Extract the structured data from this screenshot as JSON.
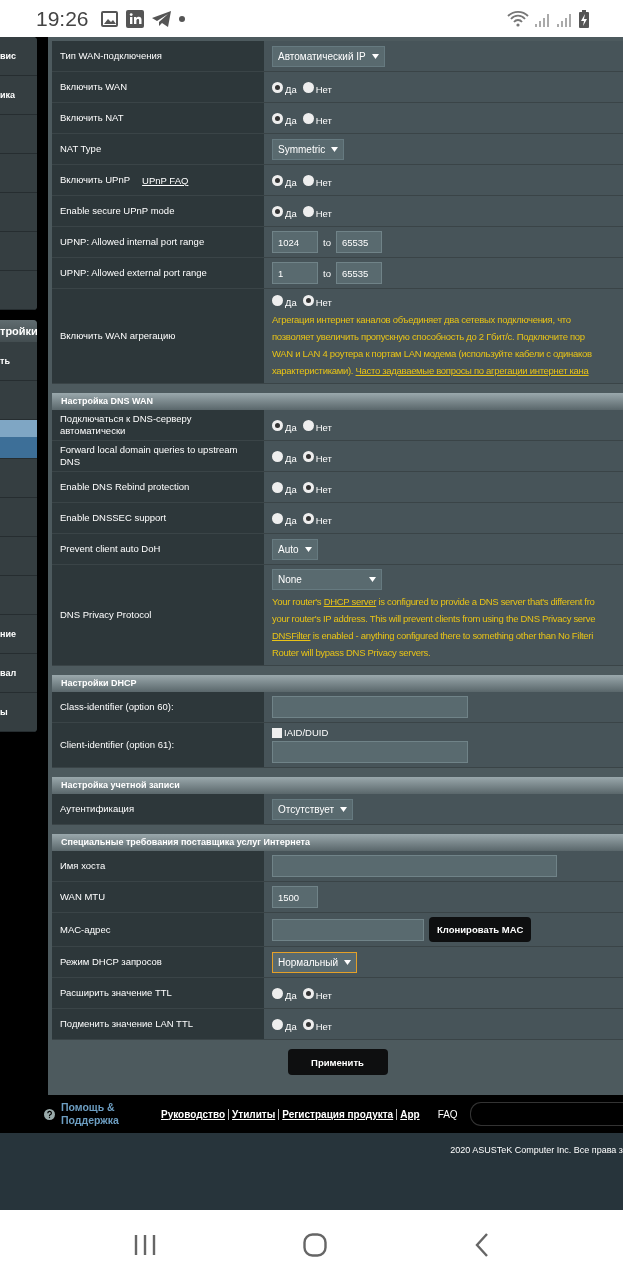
{
  "status_bar": {
    "time": "19:26"
  },
  "sidebar": {
    "groups": [
      {
        "items": [
          {
            "label": "вис",
            "selected": false
          },
          {
            "label": "ика",
            "selected": false
          },
          {
            "selected": false
          },
          {
            "selected": false
          },
          {
            "selected": false
          },
          {
            "selected": false
          },
          {
            "selected": false
          }
        ]
      },
      {
        "title": "тройки",
        "items": [
          {
            "label": "ть",
            "selected": false
          },
          {
            "selected": false
          },
          {
            "selected": true
          },
          {
            "selected": false
          },
          {
            "selected": false
          },
          {
            "selected": false
          },
          {
            "selected": false
          },
          {
            "label": "ние",
            "selected": false
          },
          {
            "label": "вал",
            "selected": false
          },
          {
            "label": "ы",
            "selected": false
          }
        ]
      }
    ]
  },
  "sections": [
    {
      "rows": [
        {
          "label": "Тип WAN-подключения",
          "kind": "select",
          "value": "Автоматический IP",
          "focused": false
        },
        {
          "label": "Включить WAN",
          "kind": "radio",
          "options": [
            {
              "label": "Да",
              "selected": true
            },
            {
              "label": "Нет",
              "selected": false
            }
          ]
        },
        {
          "label": "Включить NAT",
          "kind": "radio",
          "options": [
            {
              "label": "Да",
              "selected": true
            },
            {
              "label": "Нет",
              "selected": false
            }
          ]
        },
        {
          "label": "NAT Type",
          "kind": "select",
          "value": "Symmetric",
          "focused": false
        },
        {
          "label": "Включить UPnP",
          "link": "UPnP FAQ",
          "kind": "radio",
          "options": [
            {
              "label": "Да",
              "selected": true
            },
            {
              "label": "Нет",
              "selected": false
            }
          ]
        },
        {
          "label": "Enable secure UPnP mode",
          "kind": "radio",
          "options": [
            {
              "label": "Да",
              "selected": true
            },
            {
              "label": "Нет",
              "selected": false
            }
          ]
        },
        {
          "label": "UPNP: Allowed internal port range",
          "kind": "range",
          "from": "1024",
          "joiner": "to",
          "to": "65535"
        },
        {
          "label": "UPNP: Allowed external port range",
          "kind": "range",
          "from": "1",
          "joiner": "to",
          "to": "65535"
        },
        {
          "label": "Включить WAN агрегацию",
          "kind": "radio",
          "options": [
            {
              "label": "Да",
              "selected": false
            },
            {
              "label": "Нет",
              "selected": true
            }
          ],
          "note": [
            [
              {
                "text": "Агрегация интернет каналов объединяет два сетевых подключения, что"
              }
            ],
            [
              {
                "text": "позволяет увеличить пропускную способность до 2 Гбит/с. Подключите пор"
              }
            ],
            [
              {
                "text": "WAN и LAN 4 роутера к портам LAN модема (используйте кабели с одинаков"
              }
            ],
            [
              {
                "text": "характеристиками). "
              },
              {
                "text": "Часто задаваемые вопросы по агрегации интернет кана",
                "link": true
              }
            ]
          ]
        }
      ]
    },
    {
      "title": "Настройка DNS WAN",
      "rows": [
        {
          "label": "Подключаться к DNS-серверу автоматически",
          "kind": "radio",
          "options": [
            {
              "label": "Да",
              "selected": true
            },
            {
              "label": "Нет",
              "selected": false
            }
          ]
        },
        {
          "label": "Forward local domain queries to upstream DNS",
          "kind": "radio",
          "options": [
            {
              "label": "Да",
              "selected": false
            },
            {
              "label": "Нет",
              "selected": true
            }
          ]
        },
        {
          "label": "Enable DNS Rebind protection",
          "kind": "radio",
          "options": [
            {
              "label": "Да",
              "selected": false
            },
            {
              "label": "Нет",
              "selected": true
            }
          ]
        },
        {
          "label": "Enable DNSSEC support",
          "kind": "radio",
          "options": [
            {
              "label": "Да",
              "selected": false
            },
            {
              "label": "Нет",
              "selected": true
            }
          ]
        },
        {
          "label": "Prevent client auto DoH",
          "kind": "select",
          "value": "Auto",
          "focused": false
        },
        {
          "label": "DNS Privacy Protocol",
          "kind": "select",
          "value": "None",
          "focused": false,
          "note": [
            [
              {
                "text": "Your router's "
              },
              {
                "text": "DHCP server",
                "link": true
              },
              {
                "text": " is configured to provide a DNS server that's different fro"
              }
            ],
            [
              {
                "text": "your router's IP address. This will prevent clients from using the DNS Privacy serve"
              }
            ],
            [
              {
                "text": "DNSFilter",
                "link": true
              },
              {
                "text": " is enabled - anything configured there to something other than No Filteri"
              }
            ],
            [
              {
                "text": "Router will bypass DNS Privacy servers."
              }
            ]
          ]
        }
      ]
    },
    {
      "title": "Настройки DHCP",
      "rows": [
        {
          "label": "Class-identifier (option 60):",
          "kind": "input"
        },
        {
          "label": "Client-identifier (option 61):",
          "kind": "input",
          "checkbox": {
            "label": "IAID/DUID",
            "checked": false
          }
        }
      ]
    },
    {
      "title": "Настройка учетной записи",
      "rows": [
        {
          "label": "Аутентификация",
          "kind": "select",
          "value": "Отсутствует",
          "focused": false
        }
      ]
    },
    {
      "title": "Специальные требования поставщика услуг Интернета",
      "rows": [
        {
          "label": "Имя хоста",
          "kind": "input"
        },
        {
          "label": "WAN MTU",
          "kind": "input",
          "value": "1500"
        },
        {
          "label": "MAC-адрес",
          "kind": "input",
          "button": "Клонировать MAC"
        },
        {
          "label": "Режим DHCP запросов",
          "kind": "select",
          "value": "Нормальный",
          "focused": true
        },
        {
          "label": "Расширить значение TTL",
          "kind": "radio",
          "options": [
            {
              "label": "Да",
              "selected": false
            },
            {
              "label": "Нет",
              "selected": true
            }
          ]
        },
        {
          "label": "Подменить значение LAN TTL",
          "kind": "radio",
          "options": [
            {
              "label": "Да",
              "selected": false
            },
            {
              "label": "Нет",
              "selected": true
            }
          ]
        }
      ]
    }
  ],
  "apply_button": "Применить",
  "footer": {
    "help": "Помощь & Поддержка",
    "links": [
      "Руководство",
      "Утилиты",
      "Регистрация продукта",
      "App"
    ],
    "faq": "FAQ",
    "copyright": "2020 ASUSTeK Computer Inc. Все права з"
  }
}
